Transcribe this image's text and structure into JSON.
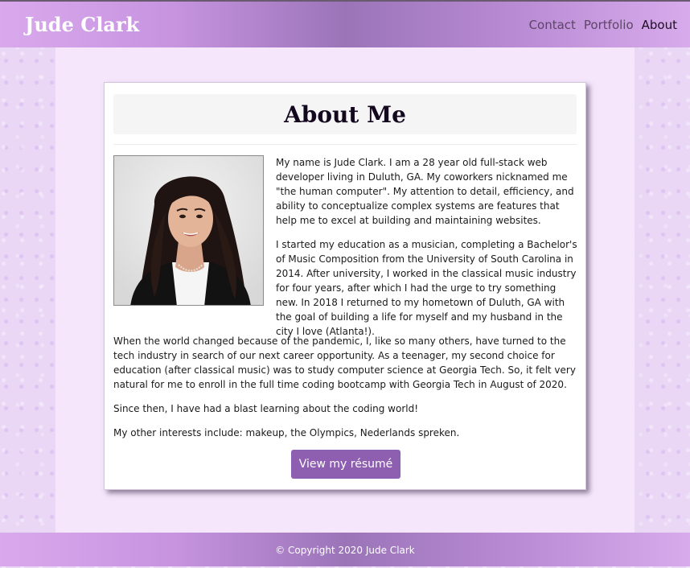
{
  "header": {
    "brand": "Jude Clark",
    "nav": [
      {
        "label": "Contact",
        "active": false
      },
      {
        "label": "Portfolio",
        "active": false
      },
      {
        "label": "About",
        "active": true
      }
    ]
  },
  "about": {
    "title": "About Me",
    "paragraphs": [
      "My name is Jude Clark. I am a 28 year old full-stack web developer living in Duluth, GA. My coworkers nicknamed me \"the human computer\". My attention to detail, efficiency, and ability to conceptualize complex systems are features that help me to excel at building and maintaining websites.",
      "I started my education as a musician, completing a Bachelor's of Music Composition from the University of South Carolina in 2014. After university, I worked in the classical music industry for four years, after which I had the urge to try something new. In 2018 I returned to my hometown of Duluth, GA with the goal of building a life for myself and my husband in the city I love (Atlanta!).",
      "When the world changed because of the pandemic, I, like so many others, have turned to the tech industry in search of our next career opportunity. As a teenager, my second choice for education (after classical music) was to study computer science at Georgia Tech. So, it felt very natural for me to enroll in the full time coding bootcamp with Georgia Tech in August of 2020.",
      "Since then, I have had a blast learning about the coding world!",
      "My other interests include: makeup, the Olympics, Nederlands spreken."
    ],
    "resume_button": "View my résumé"
  },
  "footer": {
    "copyright": "© Copyright 2020 Jude Clark"
  },
  "colors": {
    "accent": "#8e5eb0",
    "header_gradient_mid": "#9b74b8",
    "page_background": "#ead7f6",
    "panel_background": "#f5e6fc"
  }
}
